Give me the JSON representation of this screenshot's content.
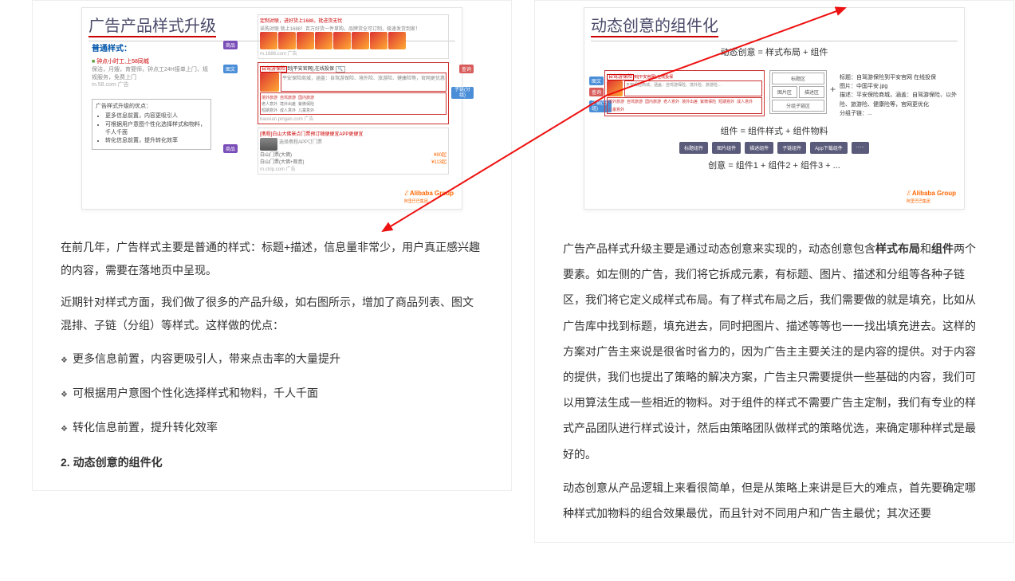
{
  "left": {
    "slide": {
      "title": "广告产品样式升级",
      "subH": "普通样式：",
      "sampleAd": {
        "t": "钟点小时工,上58同城",
        "d": "保洁，月嫂，育婴师，钟点工24H接单上门，规规服务，免费上门",
        "s": "m.58.com 广告"
      },
      "box": {
        "title": "广告样式升级的优点：",
        "items": [
          "更多信息前置，内容更吸引人",
          "可根据用户意图个性化选择样式和物料，千人千面",
          "转化信息前置，提升转化效率"
        ]
      },
      "b1": {
        "title": "定制对联，进好货上1688，批进货无忧",
        "sub": "采购对联 就上1688！百万好货一件草购，品牌货全可订制，极速发货到家！",
        "src": "m.1688.com 广告",
        "tag": "商品"
      },
      "b2": {
        "title": "到[平安官网],在线投保",
        "red": "自驾游保险",
        "sub1": "平安保险商城，涵盖：自驾游保险、境外险、旅游险、健康险等，官网更优惠",
        "links": [
          "境外旅游",
          "自驾旅游",
          "国内旅游"
        ],
        "links2": [
          "老人意外",
          "境外出差",
          "紫微保险"
        ],
        "links3": [
          "短期意外",
          "成人意外",
          "儿童意外"
        ],
        "src": "baoxian.pingan.com 广告",
        "tagA": "图文",
        "tagB": "查询",
        "tagC": "子链(分组)"
      },
      "b3": {
        "title": "[携程]白山大佛景点门票预订随便便宜APP更便宜",
        "sub": "选择携程APP订门票",
        "t1": "白山门票(大佛)",
        "v1": "¥80起",
        "t2": "白山门票(大佛+观音)",
        "v2": "¥113起",
        "src": "m.ctrip.com 广告",
        "tag": "商品"
      },
      "logo": "Alibaba Group",
      "logoSub": "阿里巴巴集团"
    },
    "para1": "在前几年，广告样式主要是普通的样式：标题+描述，信息量非常少，用户真正感兴趣的内容，需要在落地页中呈现。",
    "para2": "近期针对样式方面，我们做了很多的产品升级，如右图所示，增加了商品列表、图文混排、子链（分组）等样式。这样做的优点：",
    "bul": [
      "更多信息前置，内容更吸引人，带来点击率的大量提升",
      "可根据用户意图个性化选择样式和物料，千人千面",
      "转化信息前置，提升转化效率"
    ],
    "h2": "2.  动态创意的组件化"
  },
  "right": {
    "slide": {
      "title": "动态创意的组件化",
      "eq1": "动态创意 = 样式布局 + 组件",
      "ad": {
        "red": "自驾游保险",
        "t": "到[平安官网],在线投保",
        "sub": "平安保险商城，涵盖：自驾游保险、境外险、旅游险…",
        "links": [
          "境外旅游",
          "自驾旅游",
          "国内旅游",
          "老人意外",
          "境外出差",
          "紫微保险",
          "短期意外",
          "成人意外",
          "儿童意外"
        ]
      },
      "layout": {
        "a": "标题区",
        "b": "图片区",
        "c": "描述区",
        "d": "分组子链区"
      },
      "ann": {
        "l1": "标题：自驾游保险到平安官网 在线投保",
        "l2": "图片：中国平安.jpg",
        "l3": "描述：平安保险商城，涵盖：自驾游保险、以外险、旅游险、健康险等，官网更优化",
        "l4": "分组子链：..."
      },
      "eq2": "组件 = 组件样式 + 组件物料",
      "comps": [
        "标题组件",
        "图片组件",
        "描述组件",
        "子链组件",
        "App下载组件",
        "......"
      ],
      "eq3": "创意 = 组件1 + 组件2 + 组件3 + ...",
      "tagA": "图文",
      "tagB": "查询",
      "tagC": "子链(分组)",
      "logo": "Alibaba Group",
      "logoSub": "阿里巴巴集团"
    },
    "para1a": "广告产品样式升级主要是通过动态创意来实现的，动态创意包含",
    "b1": "样式布局",
    "mid": "和",
    "b2": "组件",
    "para1b": "两个要素。如左侧的广告，我们将它拆成元素，有标题、图片、描述和分组等各种子链区，我们将它定义成样式布局。有了样式布局之后，我们需要做的就是填充，比如从广告库中找到标题，填充进去，同时把图片、描述等等也一一找出填充进去。这样的方案对广告主来说是很省时省力的，因为广告主主要关注的是内容的提供。对于内容的提供，我们也提出了策略的解决方案，广告主只需要提供一些基础的内容，我们可以用算法生成一些相近的物料。对于组件的样式不需要广告主定制，我们有专业的样式产品团队进行样式设计，然后由策略团队做样式的策略优选，来确定哪种样式是最好的。",
    "para2": "动态创意从产品逻辑上来看很简单，但是从策略上来讲是巨大的难点，首先要确定哪种样式加物料的组合效果最优，而且针对不同用户和广告主最优；其次还要"
  }
}
